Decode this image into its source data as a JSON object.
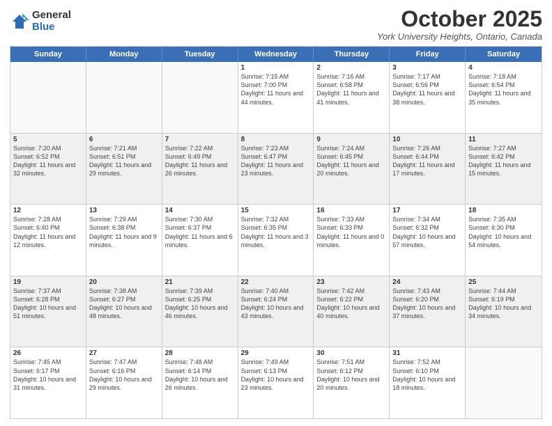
{
  "header": {
    "logo_general": "General",
    "logo_blue": "Blue",
    "month_title": "October 2025",
    "location": "York University Heights, Ontario, Canada"
  },
  "days_of_week": [
    "Sunday",
    "Monday",
    "Tuesday",
    "Wednesday",
    "Thursday",
    "Friday",
    "Saturday"
  ],
  "weeks": [
    {
      "cells": [
        {
          "day": "",
          "info": "",
          "empty": true
        },
        {
          "day": "",
          "info": "",
          "empty": true
        },
        {
          "day": "",
          "info": "",
          "empty": true
        },
        {
          "day": "1",
          "info": "Sunrise: 7:15 AM\nSunset: 7:00 PM\nDaylight: 11 hours and 44 minutes."
        },
        {
          "day": "2",
          "info": "Sunrise: 7:16 AM\nSunset: 6:58 PM\nDaylight: 11 hours and 41 minutes."
        },
        {
          "day": "3",
          "info": "Sunrise: 7:17 AM\nSunset: 6:56 PM\nDaylight: 11 hours and 38 minutes."
        },
        {
          "day": "4",
          "info": "Sunrise: 7:18 AM\nSunset: 6:54 PM\nDaylight: 11 hours and 35 minutes."
        }
      ]
    },
    {
      "cells": [
        {
          "day": "5",
          "info": "Sunrise: 7:20 AM\nSunset: 6:52 PM\nDaylight: 11 hours and 32 minutes."
        },
        {
          "day": "6",
          "info": "Sunrise: 7:21 AM\nSunset: 6:51 PM\nDaylight: 11 hours and 29 minutes."
        },
        {
          "day": "7",
          "info": "Sunrise: 7:22 AM\nSunset: 6:49 PM\nDaylight: 11 hours and 26 minutes."
        },
        {
          "day": "8",
          "info": "Sunrise: 7:23 AM\nSunset: 6:47 PM\nDaylight: 11 hours and 23 minutes."
        },
        {
          "day": "9",
          "info": "Sunrise: 7:24 AM\nSunset: 6:45 PM\nDaylight: 11 hours and 20 minutes."
        },
        {
          "day": "10",
          "info": "Sunrise: 7:26 AM\nSunset: 6:44 PM\nDaylight: 11 hours and 17 minutes."
        },
        {
          "day": "11",
          "info": "Sunrise: 7:27 AM\nSunset: 6:42 PM\nDaylight: 11 hours and 15 minutes."
        }
      ]
    },
    {
      "cells": [
        {
          "day": "12",
          "info": "Sunrise: 7:28 AM\nSunset: 6:40 PM\nDaylight: 11 hours and 12 minutes."
        },
        {
          "day": "13",
          "info": "Sunrise: 7:29 AM\nSunset: 6:38 PM\nDaylight: 11 hours and 9 minutes."
        },
        {
          "day": "14",
          "info": "Sunrise: 7:30 AM\nSunset: 6:37 PM\nDaylight: 11 hours and 6 minutes."
        },
        {
          "day": "15",
          "info": "Sunrise: 7:32 AM\nSunset: 6:35 PM\nDaylight: 11 hours and 3 minutes."
        },
        {
          "day": "16",
          "info": "Sunrise: 7:33 AM\nSunset: 6:33 PM\nDaylight: 11 hours and 0 minutes."
        },
        {
          "day": "17",
          "info": "Sunrise: 7:34 AM\nSunset: 6:32 PM\nDaylight: 10 hours and 57 minutes."
        },
        {
          "day": "18",
          "info": "Sunrise: 7:35 AM\nSunset: 6:30 PM\nDaylight: 10 hours and 54 minutes."
        }
      ]
    },
    {
      "cells": [
        {
          "day": "19",
          "info": "Sunrise: 7:37 AM\nSunset: 6:28 PM\nDaylight: 10 hours and 51 minutes."
        },
        {
          "day": "20",
          "info": "Sunrise: 7:38 AM\nSunset: 6:27 PM\nDaylight: 10 hours and 48 minutes."
        },
        {
          "day": "21",
          "info": "Sunrise: 7:39 AM\nSunset: 6:25 PM\nDaylight: 10 hours and 46 minutes."
        },
        {
          "day": "22",
          "info": "Sunrise: 7:40 AM\nSunset: 6:24 PM\nDaylight: 10 hours and 43 minutes."
        },
        {
          "day": "23",
          "info": "Sunrise: 7:42 AM\nSunset: 6:22 PM\nDaylight: 10 hours and 40 minutes."
        },
        {
          "day": "24",
          "info": "Sunrise: 7:43 AM\nSunset: 6:20 PM\nDaylight: 10 hours and 37 minutes."
        },
        {
          "day": "25",
          "info": "Sunrise: 7:44 AM\nSunset: 6:19 PM\nDaylight: 10 hours and 34 minutes."
        }
      ]
    },
    {
      "cells": [
        {
          "day": "26",
          "info": "Sunrise: 7:45 AM\nSunset: 6:17 PM\nDaylight: 10 hours and 31 minutes."
        },
        {
          "day": "27",
          "info": "Sunrise: 7:47 AM\nSunset: 6:16 PM\nDaylight: 10 hours and 29 minutes."
        },
        {
          "day": "28",
          "info": "Sunrise: 7:48 AM\nSunset: 6:14 PM\nDaylight: 10 hours and 26 minutes."
        },
        {
          "day": "29",
          "info": "Sunrise: 7:49 AM\nSunset: 6:13 PM\nDaylight: 10 hours and 23 minutes."
        },
        {
          "day": "30",
          "info": "Sunrise: 7:51 AM\nSunset: 6:12 PM\nDaylight: 10 hours and 20 minutes."
        },
        {
          "day": "31",
          "info": "Sunrise: 7:52 AM\nSunset: 6:10 PM\nDaylight: 10 hours and 18 minutes."
        },
        {
          "day": "",
          "info": "",
          "empty": true
        }
      ]
    }
  ]
}
